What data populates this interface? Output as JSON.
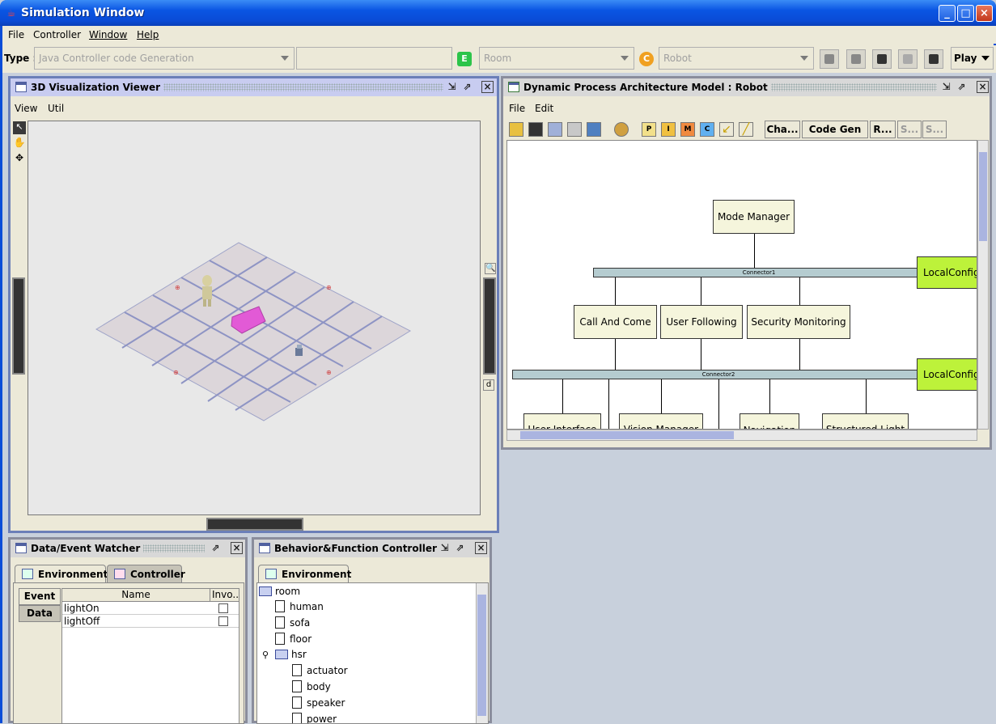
{
  "window": {
    "title": "Simulation Window"
  },
  "menubar": [
    "File",
    "Controller",
    "Window",
    "Help"
  ],
  "toolbar": {
    "type_label": "Type :",
    "type_value": "Java Controller code Generation",
    "env_badge": "E",
    "env_value": "Room",
    "ctrl_badge": "C",
    "ctrl_value": "Robot",
    "play_label": "Play"
  },
  "viewer": {
    "title": "3D Visualization Viewer",
    "menus": [
      "View",
      "Util"
    ],
    "zoom_side_label": "d"
  },
  "dpam": {
    "title": "Dynamic Process Architecture Model : Robot",
    "menus": [
      "File",
      "Edit"
    ],
    "toolbar_letters": [
      "P",
      "I",
      "M",
      "C"
    ],
    "toolbar_buttons": [
      "Cha...",
      "Code Gen ...",
      "R...",
      "S...",
      "S..."
    ],
    "nodes": {
      "mode_manager": "Mode Manager",
      "connector1": "Connector1",
      "connector2": "Connector2",
      "local_config_1": "LocalConfig",
      "local_config_2": "LocalConfig",
      "call_and_come": "Call And Come",
      "user_following": "User Following",
      "security_monitoring": "Security Monitoring",
      "user_interface": "User Interface",
      "vision_manager": "Vision Manager",
      "navigation": "Navigation",
      "structured_light": "Structured Light"
    }
  },
  "watcher": {
    "title": "Data/Event Watcher",
    "tabs": [
      "Environment",
      "Controller"
    ],
    "side_tabs": [
      "Event",
      "Data"
    ],
    "columns": [
      "Name",
      "Invo..."
    ],
    "rows": [
      {
        "name": "lightOn",
        "checked": false
      },
      {
        "name": "lightOff",
        "checked": false
      }
    ]
  },
  "behavior": {
    "title": "Behavior&Function Controller",
    "tab": "Environment",
    "tree": {
      "root": "room",
      "l1": [
        "human",
        "sofa",
        "floor",
        "hsr"
      ],
      "hsr_children": [
        "actuator",
        "body",
        "speaker",
        "power"
      ]
    }
  },
  "colors": {
    "titlebar": "#0a55e3",
    "local_config": "#bdf23a",
    "node_fill": "#f5f5dc",
    "bus": "#b5ccd0"
  }
}
